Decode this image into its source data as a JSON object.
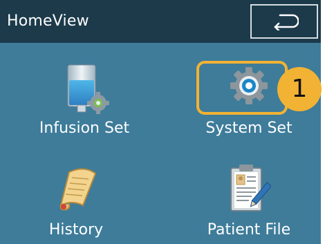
{
  "header": {
    "title": "HomeView",
    "back_icon": "return-arrow-icon"
  },
  "tiles": [
    {
      "label": "Infusion Set",
      "icon": "infusion-bag-gear-icon"
    },
    {
      "label": "System Set",
      "icon": "gear-icon"
    },
    {
      "label": "History",
      "icon": "scroll-icon"
    },
    {
      "label": "Patient File",
      "icon": "clipboard-pen-icon"
    }
  ],
  "callout": {
    "number": "1"
  },
  "colors": {
    "title_bar": "#1c3a4a",
    "screen_bg": "#3e7c9a",
    "callout": "#f2b233"
  }
}
